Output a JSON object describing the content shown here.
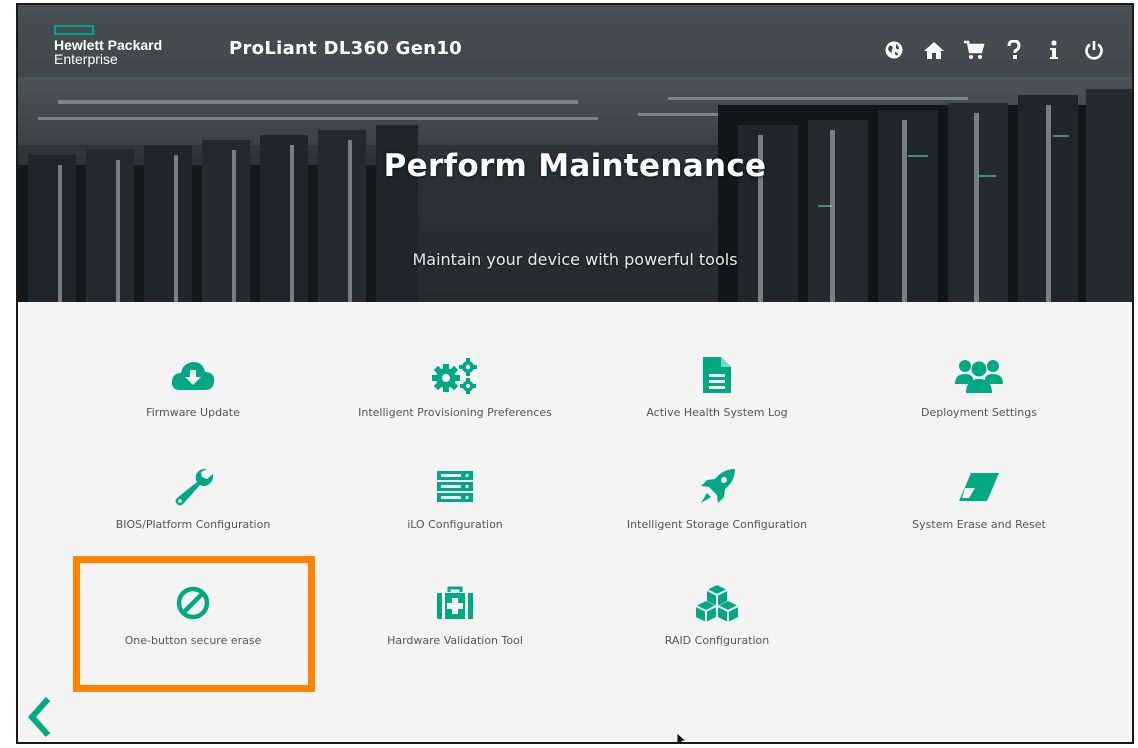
{
  "header": {
    "logo_line1": "Hewlett Packard",
    "logo_line2": "Enterprise",
    "product": "ProLiant DL360 Gen10",
    "icons": [
      "globe-icon",
      "home-icon",
      "cart-icon",
      "help-icon",
      "info-icon",
      "power-icon"
    ]
  },
  "hero": {
    "title": "Perform Maintenance",
    "subtitle": "Maintain your device with powerful tools"
  },
  "tiles": [
    {
      "label": "Firmware Update",
      "icon": "cloud-download-icon"
    },
    {
      "label": "Intelligent Provisioning Preferences",
      "icon": "gears-icon"
    },
    {
      "label": "Active Health System Log",
      "icon": "document-icon"
    },
    {
      "label": "Deployment Settings",
      "icon": "users-icon"
    },
    {
      "label": "BIOS/Platform Configuration",
      "icon": "wrench-icon"
    },
    {
      "label": "iLO Configuration",
      "icon": "server-icon"
    },
    {
      "label": "Intelligent Storage Configuration",
      "icon": "rocket-icon"
    },
    {
      "label": "System Erase and Reset",
      "icon": "eraser-icon"
    },
    {
      "label": "One-button secure erase",
      "icon": "ban-icon",
      "highlighted": true
    },
    {
      "label": "Hardware Validation Tool",
      "icon": "medkit-icon"
    },
    {
      "label": "RAID Configuration",
      "icon": "cubes-icon"
    }
  ],
  "colors": {
    "accent": "#01a982",
    "highlight": "#ff8300",
    "tile_label": "#555555",
    "background": "#f4f4f4"
  },
  "back_icon": "chevron-left-icon"
}
